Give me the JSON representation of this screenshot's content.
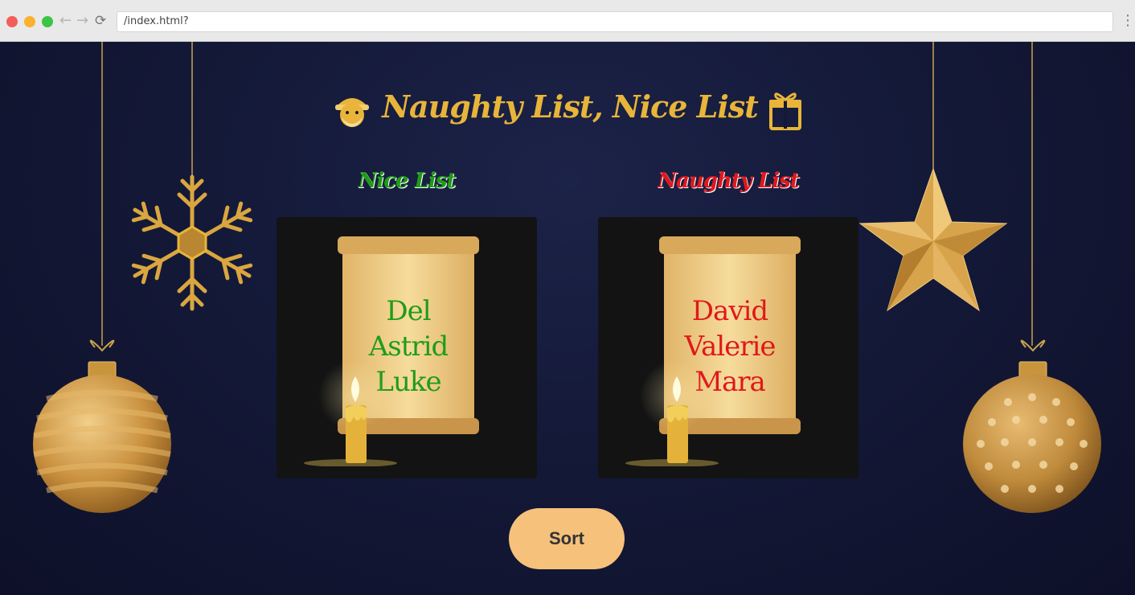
{
  "browser": {
    "url": "/index.html?",
    "back_icon": "←",
    "forward_icon": "→",
    "reload_icon": "⟳",
    "menu_icon": "⋮"
  },
  "header": {
    "title": "Naughty List, Nice List"
  },
  "nice_list": {
    "heading": "Nice List",
    "names": [
      "Del",
      "Astrid",
      "Luke"
    ],
    "color": "#1f9c18"
  },
  "naughty_list": {
    "heading": "Naughty List",
    "names": [
      "David",
      "Valerie",
      "Mara"
    ],
    "color": "#e0181c"
  },
  "sort_button": {
    "label": "Sort",
    "color": "#f6c17b"
  },
  "colors": {
    "background": "#141938",
    "gold": "#e8b53a",
    "panel": "#131313"
  },
  "decorations": [
    "striped-ornament-icon",
    "snowflake-icon",
    "star-ornament-icon",
    "dotted-ornament-icon"
  ]
}
